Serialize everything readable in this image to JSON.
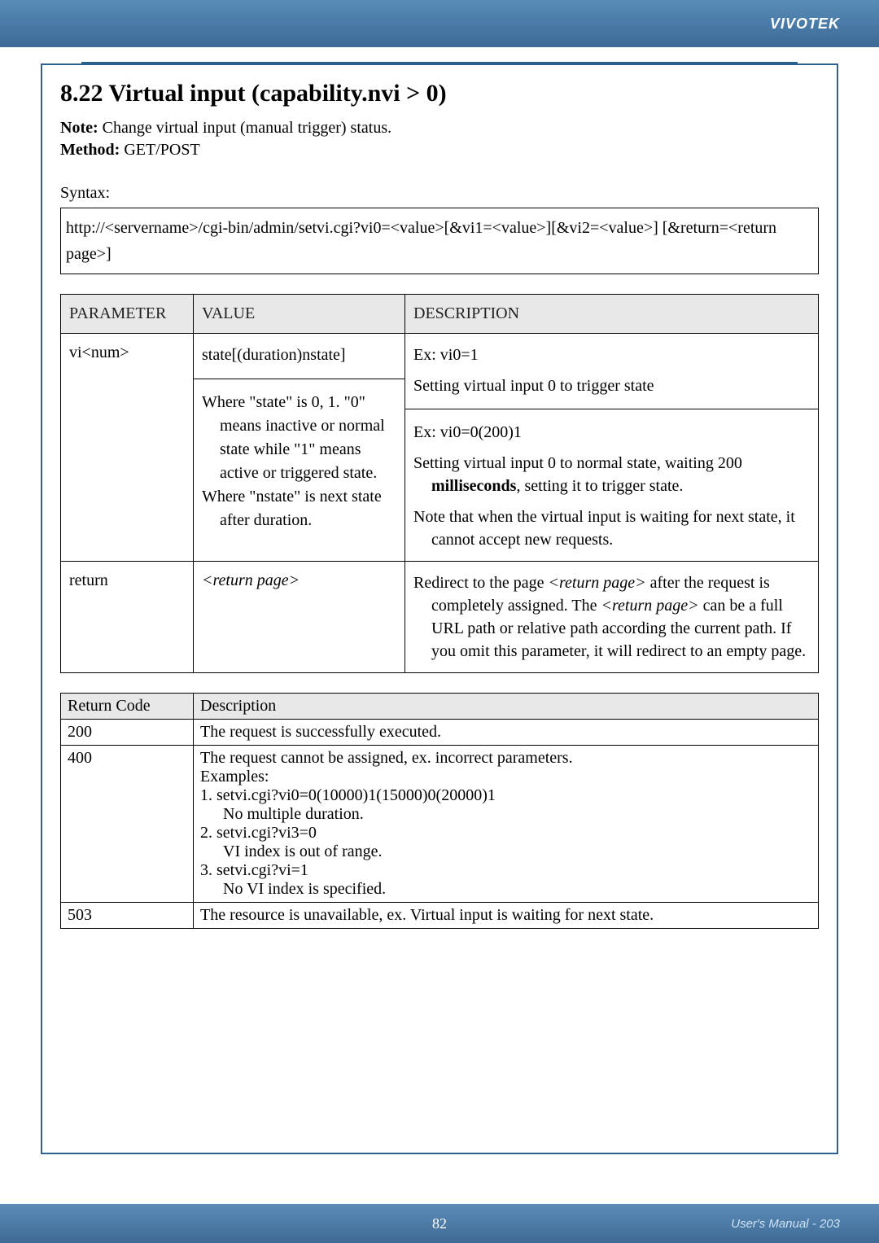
{
  "header": {
    "brand": "VIVOTEK"
  },
  "section": {
    "title": "8.22 Virtual input (capability.nvi > 0)",
    "note_label": "Note:",
    "note_text": " Change virtual input (manual trigger) status.",
    "method_label": "Method:",
    "method_text": " GET/POST",
    "syntax_label": "Syntax:",
    "syntax_box": "http://<servername>/cgi-bin/admin/setvi.cgi?vi0=<value>[&vi1=<value>][&vi2=<value>] [&return=<return page>]"
  },
  "param_table": {
    "headers": {
      "c1": "PARAMETER",
      "c2": "VALUE",
      "c3": "DESCRIPTION"
    },
    "rows": [
      {
        "param": "vi<num>",
        "value_part1": "state[(duration)nstate]",
        "value_part2_lines": [
          "Where \"state\" is 0, 1. \"0\" means inactive or normal state while \"1\" means active or triggered state.",
          "Where \"nstate\" is next state after duration."
        ],
        "desc_part1": {
          "l1": "Ex: vi0=1",
          "l2": "Setting virtual input 0 to trigger state"
        },
        "desc_part2": {
          "l1": "Ex: vi0=0(200)1",
          "l2a": "Setting virtual input 0 to normal state, waiting 200 ",
          "l2b": "milliseconds",
          "l2c": ", setting it to trigger state.",
          "l3": "Note that when the virtual input is waiting for next state, it cannot accept new requests."
        }
      },
      {
        "param": "return",
        "value": "<return page>",
        "desc_a": "Redirect to the page ",
        "desc_b": "<return page>",
        "desc_c": " after the request is completely assigned. The ",
        "desc_d": "<return page>",
        "desc_e": " can be a full URL path or relative path according the current path. If you omit this parameter, it will redirect to an empty page."
      }
    ]
  },
  "return_table": {
    "headers": {
      "c1": "Return Code",
      "c2": "Description"
    },
    "rows": [
      {
        "code": "200",
        "desc": "The request is successfully executed."
      },
      {
        "code": "400",
        "lines": [
          "The request cannot be assigned, ex. incorrect parameters.",
          "Examples:",
          "1. setvi.cgi?vi0=0(10000)1(15000)0(20000)1",
          "No multiple duration.",
          "2. setvi.cgi?vi3=0",
          "VI index is out of range.",
          "3. setvi.cgi?vi=1",
          "No VI index is specified."
        ]
      },
      {
        "code": "503",
        "desc": "The resource is unavailable, ex. Virtual input is waiting for next state."
      }
    ]
  },
  "footer": {
    "inner_page": "82",
    "outer_page": "User's Manual - 203"
  }
}
